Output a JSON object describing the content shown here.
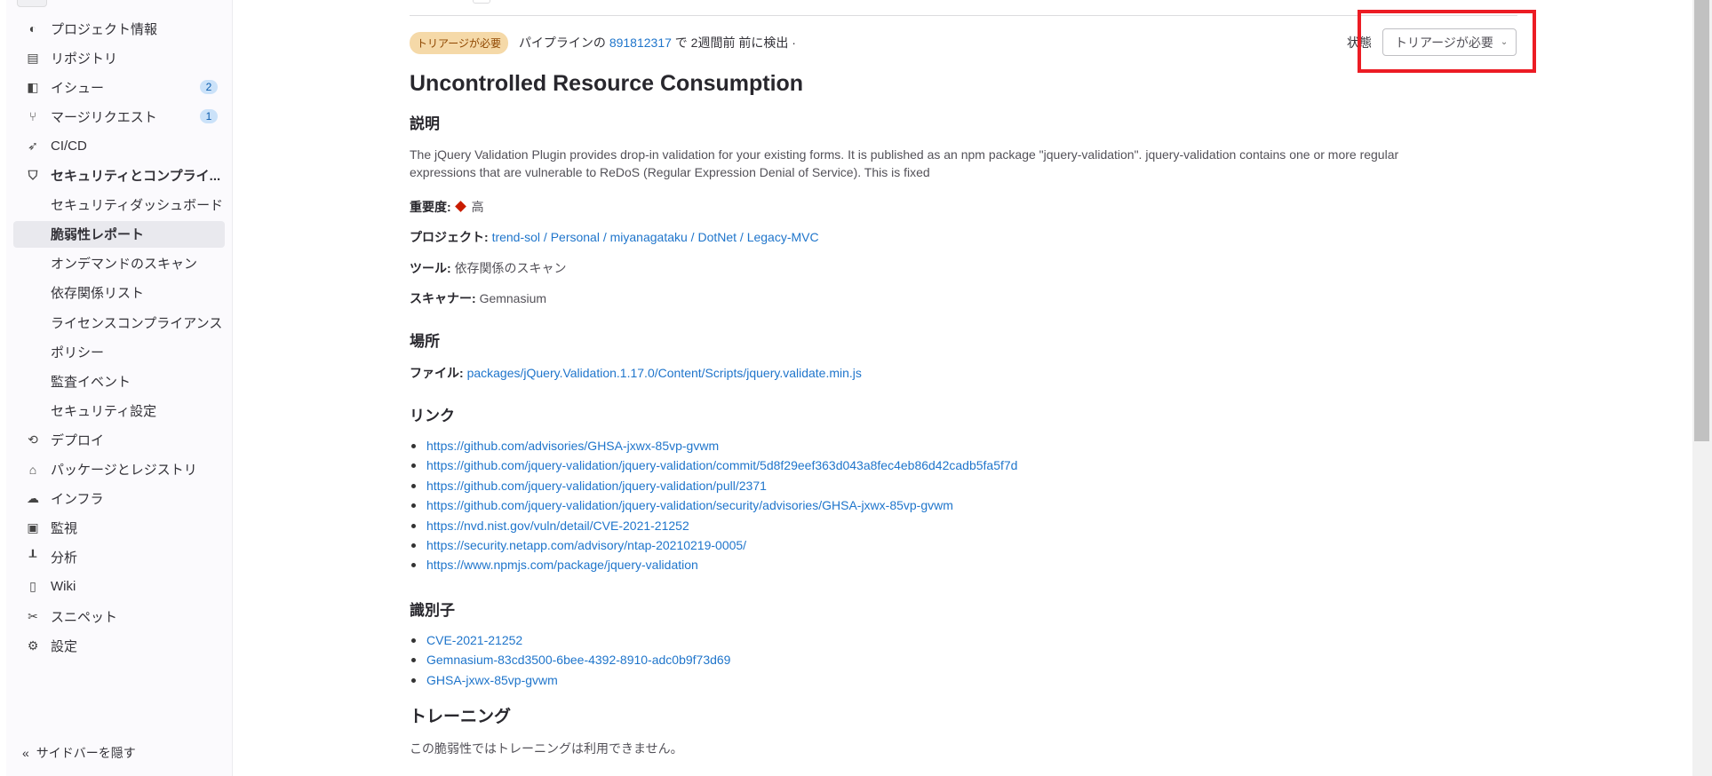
{
  "sidebar": {
    "items": [
      {
        "label": "プロジェクト情報",
        "icon": "project-icon"
      },
      {
        "label": "リポジトリ",
        "icon": "document-icon"
      },
      {
        "label": "イシュー",
        "icon": "issues-icon",
        "count": "2"
      },
      {
        "label": "マージリクエスト",
        "icon": "merge-request-icon",
        "count": "1"
      },
      {
        "label": "CI/CD",
        "icon": "rocket-icon"
      },
      {
        "label": "セキュリティとコンプライ...",
        "icon": "shield-icon"
      },
      {
        "label": "セキュリティダッシュボード"
      },
      {
        "label": "脆弱性レポート",
        "active": true
      },
      {
        "label": "オンデマンドのスキャン"
      },
      {
        "label": "依存関係リスト"
      },
      {
        "label": "ライセンスコンプライアンス"
      },
      {
        "label": "ポリシー"
      },
      {
        "label": "監査イベント"
      },
      {
        "label": "セキュリティ設定"
      },
      {
        "label": "デプロイ",
        "icon": "deploy-icon"
      },
      {
        "label": "パッケージとレジストリ",
        "icon": "package-icon"
      },
      {
        "label": "インフラ",
        "icon": "cloud-gear-icon"
      },
      {
        "label": "監視",
        "icon": "monitor-icon"
      },
      {
        "label": "分析",
        "icon": "chart-icon"
      },
      {
        "label": "Wiki",
        "icon": "book-icon"
      },
      {
        "label": "スニペット",
        "icon": "scissors-icon"
      },
      {
        "label": "設定",
        "icon": "gear-icon"
      }
    ],
    "hide_label": "サイドバーを隠す"
  },
  "header": {
    "status_badge": "トリアージが必要",
    "detected_prefix": "パイプラインの",
    "pipeline_id": "891812317",
    "detected_suffix": "で 2週間前 前に検出 ·",
    "status_label": "状態",
    "status_value": "トリアージが必要"
  },
  "vuln": {
    "title": "Uncontrolled Resource Consumption",
    "description_heading": "説明",
    "description_line1": "The jQuery Validation Plugin provides drop-in validation for your existing forms. It is published as an npm package \"jquery-validation\". jquery-validation contains one or more regular",
    "description_line2": "expressions that are vulnerable to ReDoS (Regular Expression Denial of Service). This is fixed",
    "severity_label": "重要度:",
    "severity_value": "高",
    "severity_color": "#c91c00",
    "project_label": "プロジェクト:",
    "project_value": "trend-sol / Personal / miyanagataku / DotNet / Legacy-MVC",
    "tool_label": "ツール:",
    "tool_value": "依存関係のスキャン",
    "scanner_label": "スキャナー:",
    "scanner_value": "Gemnasium",
    "location_heading": "場所",
    "file_label": "ファイル:",
    "file_value": "packages/jQuery.Validation.1.17.0/Content/Scripts/jquery.validate.min.js",
    "links_heading": "リンク",
    "links": [
      "https://github.com/advisories/GHSA-jxwx-85vp-gvwm",
      "https://github.com/jquery-validation/jquery-validation/commit/5d8f29eef363d043a8fec4eb86d42cadb5fa5f7d",
      "https://github.com/jquery-validation/jquery-validation/pull/2371",
      "https://github.com/jquery-validation/jquery-validation/security/advisories/GHSA-jxwx-85vp-gvwm",
      "https://nvd.nist.gov/vuln/detail/CVE-2021-21252",
      "https://security.netapp.com/advisory/ntap-20210219-0005/",
      "https://www.npmjs.com/package/jquery-validation"
    ],
    "identifiers_heading": "識別子",
    "identifiers": [
      "CVE-2021-21252",
      "Gemnasium-83cd3500-6bee-4392-8910-adc0b9f73d69",
      "GHSA-jxwx-85vp-gvwm"
    ],
    "training_heading": "トレーニング",
    "training_text": "この脆弱性ではトレーニングは利用できません。"
  }
}
